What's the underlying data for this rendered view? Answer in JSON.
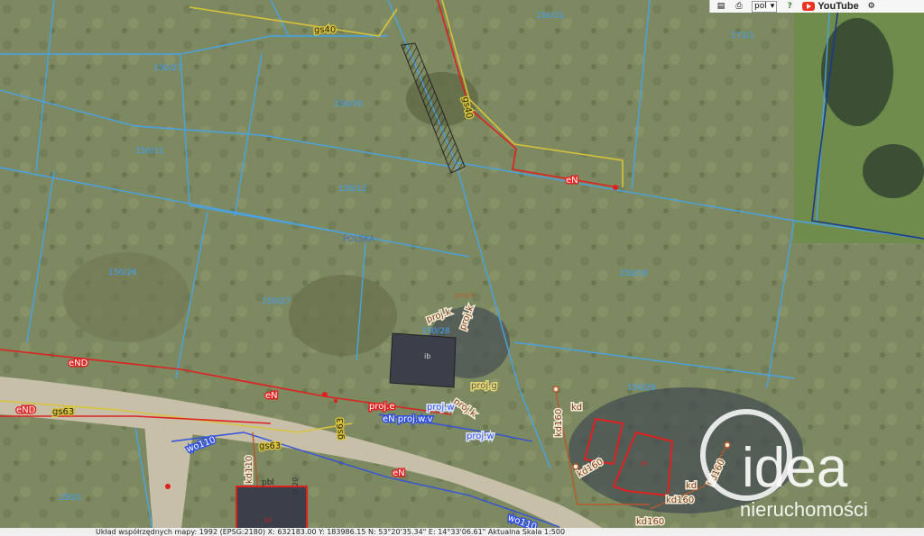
{
  "toolbar": {
    "language": "pol",
    "youtube": "YouTube"
  },
  "parcels": [
    "150/21",
    "171/1",
    "150/27",
    "150/30",
    "150/11",
    "150/12",
    "150/26",
    "150/27",
    "150/28",
    "150/19",
    "150/29",
    "150/1"
  ],
  "place_name": "POLSKA",
  "utilities": {
    "gs40_top": "gs40",
    "gs40_vertical": "gs40",
    "eN_top": "eN",
    "eND_left": "eND",
    "eN_mid": "eN",
    "eND_left2": "eND",
    "gs63": "gs63",
    "gs63_b": "gs63",
    "gs63_c": "gs63",
    "proj_k1": "proj.k",
    "proj_k2": "proj.k",
    "proj_k3": "proj.k",
    "proj_k4": "proj.k",
    "proj_g": "proj.g",
    "proj_e": "proj.e",
    "eN_proj_w_v": "eN proj.w.v",
    "proj_w": "proj.w",
    "proj_w2": "proj.w",
    "wo110": "wo110",
    "wo110_b": "wo110",
    "kd110": "kd110",
    "kd": "kd",
    "kd160": "kd160",
    "kd160_b": "kd160",
    "kd160_c": "kd160",
    "kd160_d": "kd160",
    "kd160_e": "kd160",
    "kd_b": "kd",
    "eN_low": "eN",
    "ctv20": "ct.20",
    "pbl": "pbl",
    "nl": "nl",
    "m": "m",
    "ib": "ib"
  },
  "status": "Układ współrzędnych mapy: 1992 (EPSG:2180)   X: 632183.00   Y: 183986.15   N: 53°20'35.34\"   E: 14°33'06.61\"   Aktualna Skala 1:500",
  "logo": {
    "brand": "idea",
    "sub": "nieruchomości"
  },
  "colors": {
    "parcel": "#4aa3e6",
    "power": "#e02020",
    "gas": "#d8c33a",
    "water": "#3050e0",
    "sewer": "#b35a2a",
    "building": "#e02020"
  }
}
